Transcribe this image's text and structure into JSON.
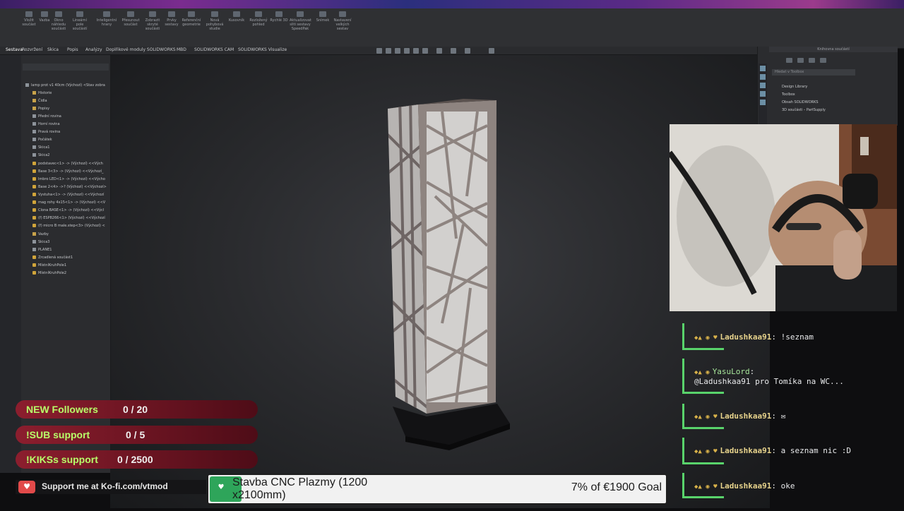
{
  "ribbon": {
    "tools": [
      "Vložit součást",
      "Vazba",
      "Okno náhledu součásti",
      "Lineární pole součástí",
      "Inteligentní hrany",
      "Přesunout součást",
      "Zobrazit skryté součásti",
      "Prvky sestavy",
      "Referenční geometrie",
      "Nová pohybová studie",
      "Kusovník",
      "Rozložený pohled",
      "Rychlé 3D",
      "Snímek",
      "Aktualizovat sliti sestavy SpeedPak",
      "Nastavení velkých sestav"
    ]
  },
  "tabs": [
    "Sestava",
    "Rozvržení",
    "Skica",
    "Popis",
    "Analýzy",
    "Doplňkové moduly SOLIDWORKS",
    "MBD",
    "SOLIDWORKS CAM",
    "SOLIDWORKS Visualize"
  ],
  "tree": {
    "root": "lamp prot v1 40cm (Výchozí) <Stav zobra",
    "items": [
      {
        "label": "Historie",
        "type": "folder"
      },
      {
        "label": "Čidla",
        "type": "folder"
      },
      {
        "label": "Popisy",
        "type": "folder"
      },
      {
        "label": "Přední rovina",
        "type": "plane"
      },
      {
        "label": "Horní rovina",
        "type": "plane"
      },
      {
        "label": "Pravá rovina",
        "type": "plane"
      },
      {
        "label": "Počátek",
        "type": "plane"
      },
      {
        "label": "Skica1",
        "type": "plane"
      },
      {
        "label": "Skica2",
        "type": "plane"
      },
      {
        "label": "podstavec<1> -> (Výchozí) <<Vých",
        "type": "part"
      },
      {
        "label": "Base 3<3> -> (Výchozí) <<Výchozí_",
        "type": "part"
      },
      {
        "label": "lmbro LED<1> -> (Výchozí) <<Výcho",
        "type": "part"
      },
      {
        "label": "Base 2<4> ->? (Výchozí) <<Výchozí>",
        "type": "part"
      },
      {
        "label": "Vystuha<1> -> (Výchozí) <<Výchozí",
        "type": "part"
      },
      {
        "label": "mag rohy 4x15<1> -> (Výchozí) <<V",
        "type": "part"
      },
      {
        "label": "Clona BASE<1> -> (Výchozí) <<Výcl",
        "type": "part"
      },
      {
        "label": "(f) ESP8266<1> (Výchozí) <<Výchozí",
        "type": "part"
      },
      {
        "label": "(f) micro B male.step<3> (Výchozí) <",
        "type": "part"
      },
      {
        "label": "Vazby",
        "type": "folder"
      },
      {
        "label": "Skica3",
        "type": "plane"
      },
      {
        "label": "PLANE1",
        "type": "plane"
      },
      {
        "label": "Zrcadlená součást1",
        "type": "part"
      },
      {
        "label": "MístníKruhPole1",
        "type": "part"
      },
      {
        "label": "MístníKruhPole2",
        "type": "part"
      }
    ]
  },
  "task_pane": {
    "title": "Knihovna součástí",
    "search_placeholder": "Hledat v Toolbox",
    "items": [
      "Design Library",
      "Toolbox",
      "Obsah SOLIDWORKS",
      "3D součásti – PartSupply"
    ]
  },
  "chat": [
    {
      "user": "Ladushkaa91",
      "message": "!seznam",
      "badges": "◆▲ ◉ ♥"
    },
    {
      "user": "YasuLord",
      "message": "@Ladushkaa91 pro Tomíka na WC...",
      "badges": "◆▲ ◉"
    },
    {
      "user": "Ladushkaa91",
      "message": "✉",
      "badges": "◆▲ ◉ ♥"
    },
    {
      "user": "Ladushkaa91",
      "message": "a seznam nic :D",
      "badges": "◆▲ ◉ ♥"
    },
    {
      "user": "Ladushkaa91",
      "message": "oke",
      "badges": "◆▲ ◉ ♥"
    }
  ],
  "goals": [
    {
      "label": "NEW Followers",
      "value": "0 / 20"
    },
    {
      "label": "!SUB support",
      "value": "0 / 5"
    },
    {
      "label": "!KIKSs support",
      "value": "0 / 2500"
    }
  ],
  "kofi": {
    "support_text": "Support me at Ko-fi.com/vtmod",
    "goal_title": "Stavba CNC Plazmy (1200 x2100mm)",
    "goal_progress_text": "7% of €1900 Goal",
    "goal_progress_fraction": 0.07
  },
  "colors": {
    "chat_accent": "#59d36b",
    "goal_label": "#b8ff6a",
    "kofi_green": "#2ea55a"
  }
}
